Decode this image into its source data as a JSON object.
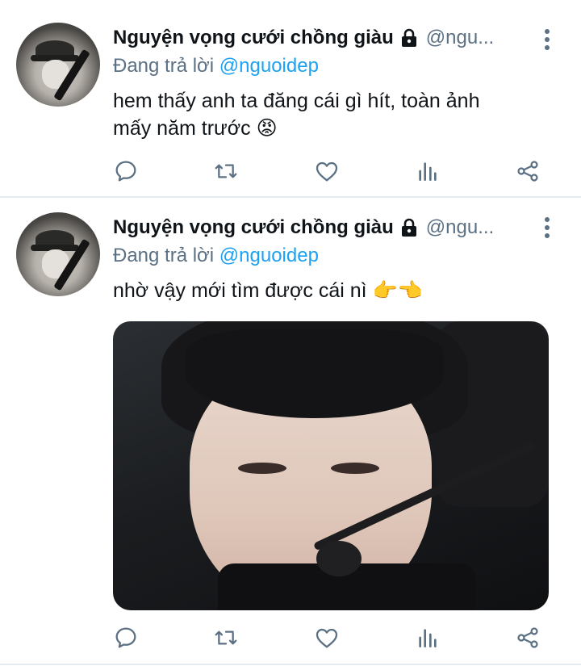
{
  "tweets": [
    {
      "display_name": "Nguyện vọng cưới chồng giàu",
      "handle": "@ngu...",
      "reply_prefix": "Đang trả lời",
      "reply_to": "@nguoidep",
      "text_line1": "hem thấy anh ta đăng cái gì hít, toàn ảnh",
      "text_line2": "mấy năm trước 😡",
      "has_media": false
    },
    {
      "display_name": "Nguyện vọng cưới chồng giàu",
      "handle": "@ngu...",
      "reply_prefix": "Đang trả lời",
      "reply_to": "@nguoidep",
      "text_line1": "nhờ vậy mới tìm được cái nì 👉👈",
      "has_media": true
    }
  ],
  "icons": {
    "reply": "reply-icon",
    "retweet": "retweet-icon",
    "like": "heart-icon",
    "analytics": "analytics-icon",
    "share": "share-icon",
    "more": "more-vertical-icon",
    "lock": "lock-icon"
  },
  "colors": {
    "text": "#0f1419",
    "secondary": "#5b7083",
    "link": "#1da1f2",
    "divider": "#e6ecf0"
  }
}
